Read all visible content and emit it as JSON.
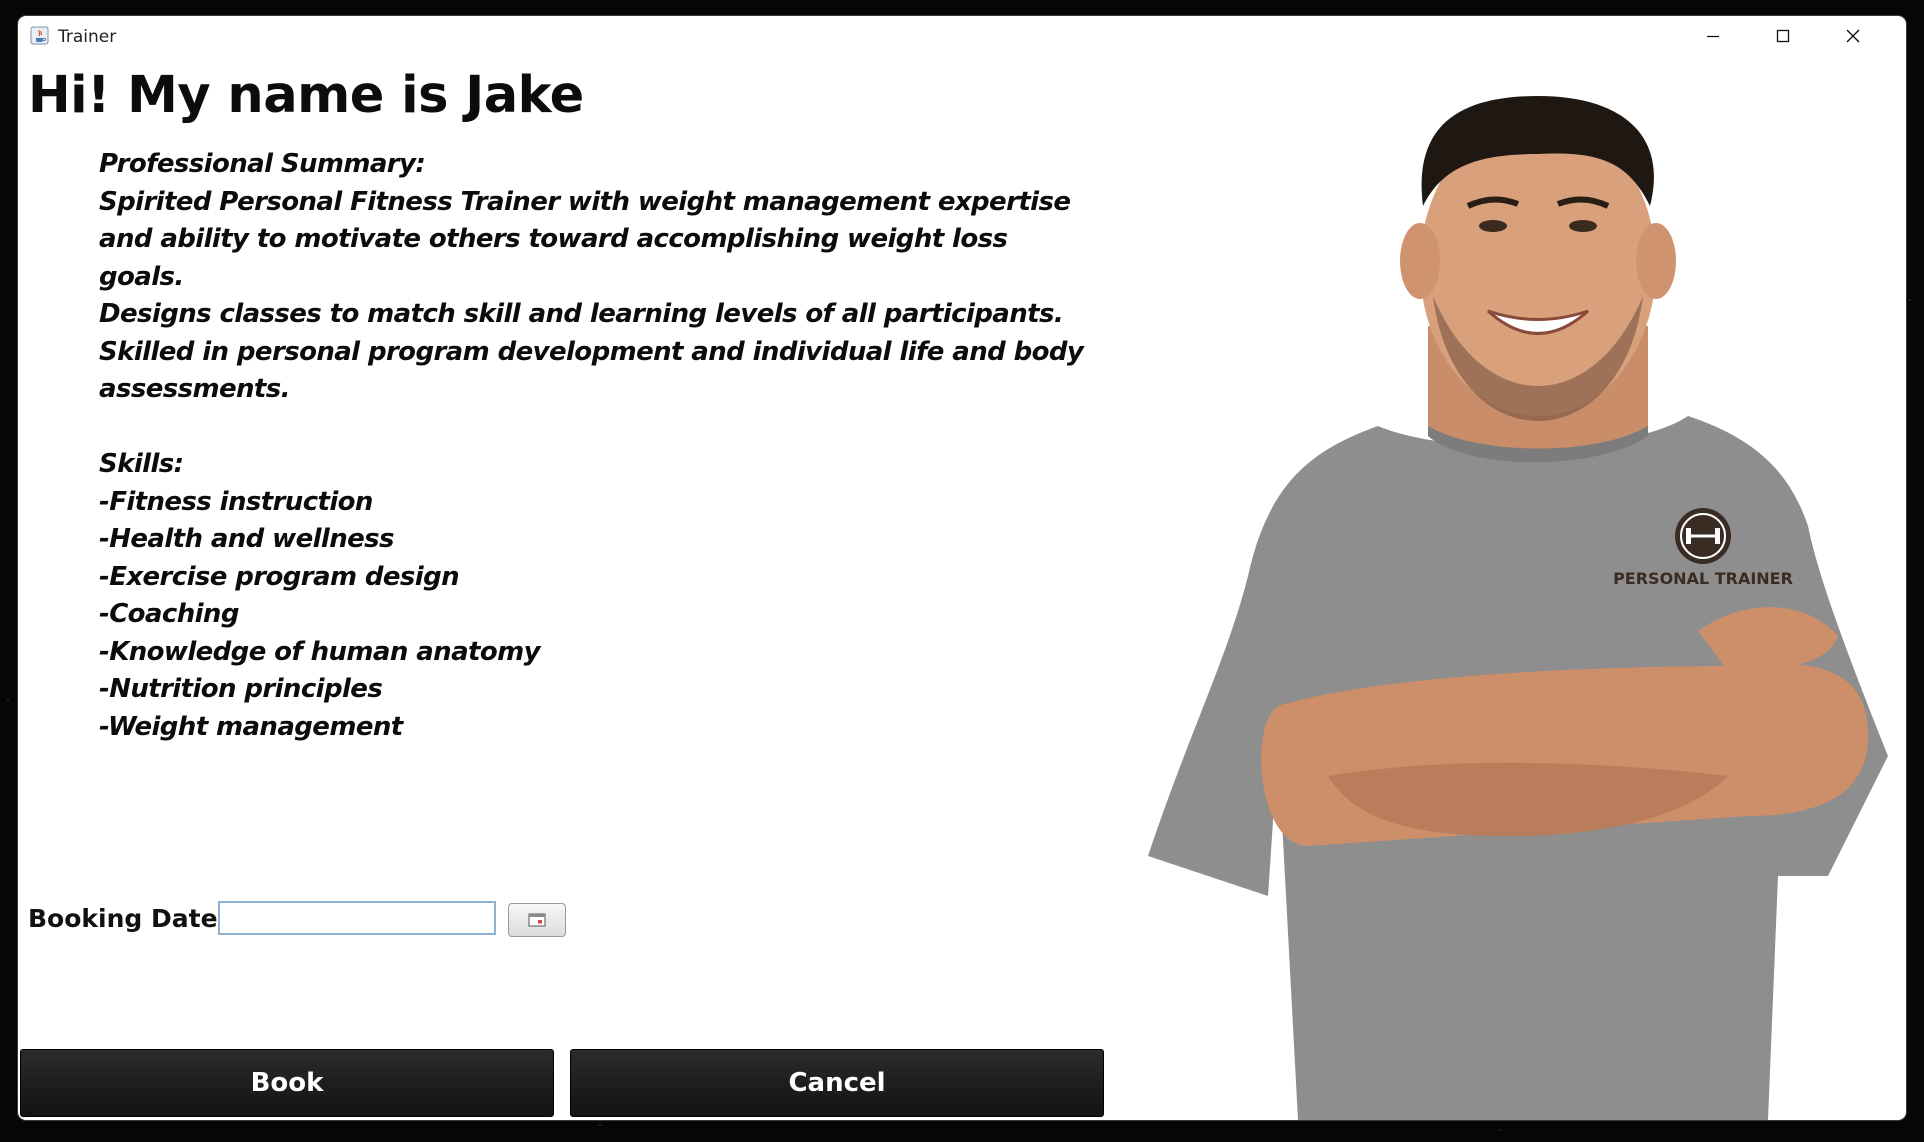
{
  "window": {
    "title": "Trainer"
  },
  "profile": {
    "greeting": "Hi! My name is Jake",
    "bio": "Professional Summary:\nSpirited Personal Fitness Trainer with weight management expertise\nand ability to motivate others toward accomplishing weight loss goals.\nDesigns classes to match skill and learning levels of all participants.\nSkilled in personal program development and individual life and body\nassessments.\n\nSkills:\n-Fitness instruction\n-Health and wellness\n-Exercise program design\n-Coaching\n-Knowledge of human anatomy\n-Nutrition principles\n-Weight management"
  },
  "booking": {
    "label": "Booking Date:",
    "value": ""
  },
  "actions": {
    "book_label": "Book",
    "cancel_label": "Cancel"
  },
  "photo": {
    "shirt_print": "PERSONAL TRAINER"
  },
  "colors": {
    "button_bg": "#1c1c1c",
    "button_text": "#ffffff",
    "shirt": "#8e8e8e",
    "skin": "#d9a07c",
    "hair": "#1f1812"
  }
}
